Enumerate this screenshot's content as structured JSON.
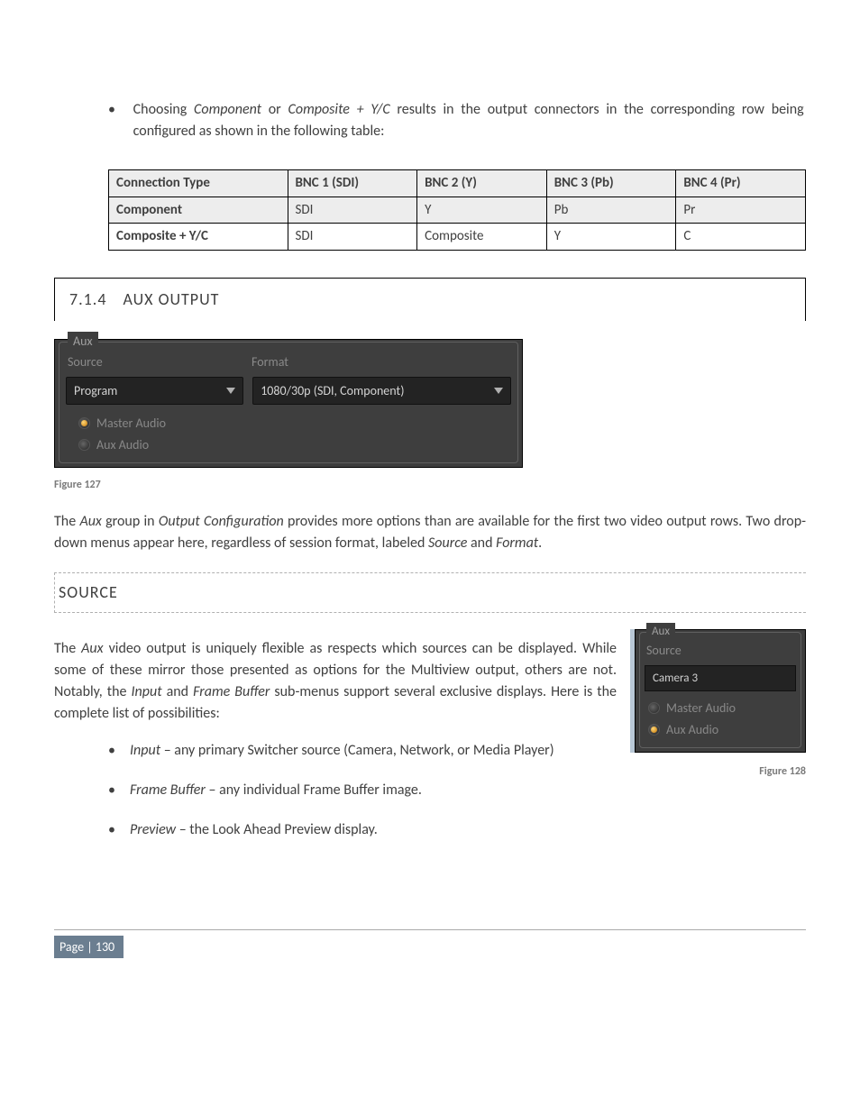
{
  "top_bullet": {
    "prefix": "Choosing ",
    "i1": "Component",
    "mid": " or ",
    "i2": "Composite + Y/C",
    "rest": " results in the output connectors in the corresponding row being configured as shown in the following table:"
  },
  "table": {
    "headers": [
      "Connection Type",
      "BNC 1 (SDI)",
      "BNC 2 (Y)",
      "BNC 3 (Pb)",
      "BNC 4 (Pr)"
    ],
    "rows": [
      [
        "Component",
        "SDI",
        "Y",
        "Pb",
        "Pr"
      ],
      [
        "Composite + Y/C",
        "SDI",
        "Composite",
        "Y",
        "C"
      ]
    ]
  },
  "section": {
    "num": "7.1.4",
    "title": "AUX OUTPUT"
  },
  "aux_panel": {
    "legend": "Aux",
    "source_lbl": "Source",
    "format_lbl": "Format",
    "source_val": "Program",
    "format_val": "1080/30p (SDI, Component)",
    "radio1": "Master Audio",
    "radio2": "Aux Audio"
  },
  "fig127": "Figure 127",
  "para1": {
    "t1": "The ",
    "i1": "Aux",
    "t2": " group in ",
    "i2": "Output Configuration",
    "t3": " provides more options than are available for the first two video output rows.  Two drop-down menus appear here, regardless of session format, labeled ",
    "i3": "Source",
    "t4": " and ",
    "i4": "Format",
    "t5": "."
  },
  "source_hdr": "SOURCE",
  "para2": {
    "t1": "The ",
    "i1": "Aux",
    "t2": " video output is uniquely flexible as respects which sources can be displayed. While some of these mirror those presented as options for the Multiview output, others are not.  Notably, the ",
    "i2": "Input",
    "t3": " and ",
    "i3": "Frame Buffer",
    "t4": " sub-menus support several exclusive displays. Here is the complete list of possibilities:"
  },
  "mini_panel": {
    "legend": "Aux",
    "source_lbl": "Source",
    "source_val": "Camera 3",
    "radio1": "Master Audio",
    "radio2": "Aux Audio"
  },
  "fig128": "Figure 128",
  "list": [
    {
      "i": "Input",
      "rest": " – any primary Switcher source (Camera, Network, or Media Player)"
    },
    {
      "i": "Frame Buffer",
      "rest": " – any individual Frame Buffer image."
    },
    {
      "i": "Preview",
      "rest": " – the Look Ahead Preview display."
    }
  ],
  "footer": "Page | 130"
}
